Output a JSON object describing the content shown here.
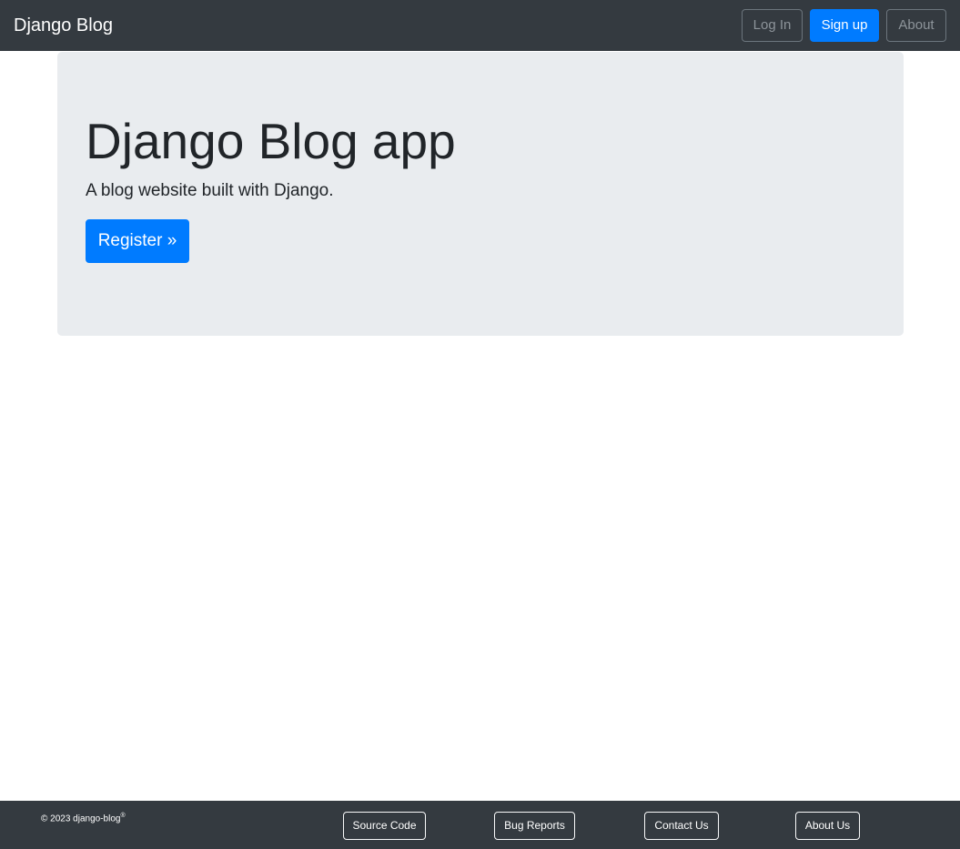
{
  "navbar": {
    "brand": "Django Blog",
    "login_label": "Log In",
    "signup_label": "Sign up",
    "about_label": "About"
  },
  "jumbotron": {
    "title": "Django Blog app",
    "lead": "A blog website built with Django.",
    "register_label": "Register »"
  },
  "footer": {
    "copyright_prefix": "© 2023 django-blog",
    "copyright_mark": "®",
    "links": [
      {
        "label": "Source Code"
      },
      {
        "label": "Bug Reports"
      },
      {
        "label": "Contact Us"
      },
      {
        "label": "About Us"
      }
    ]
  },
  "colors": {
    "navbar_bg": "#343a40",
    "primary": "#007bff",
    "jumbotron_bg": "#e9ecef"
  }
}
